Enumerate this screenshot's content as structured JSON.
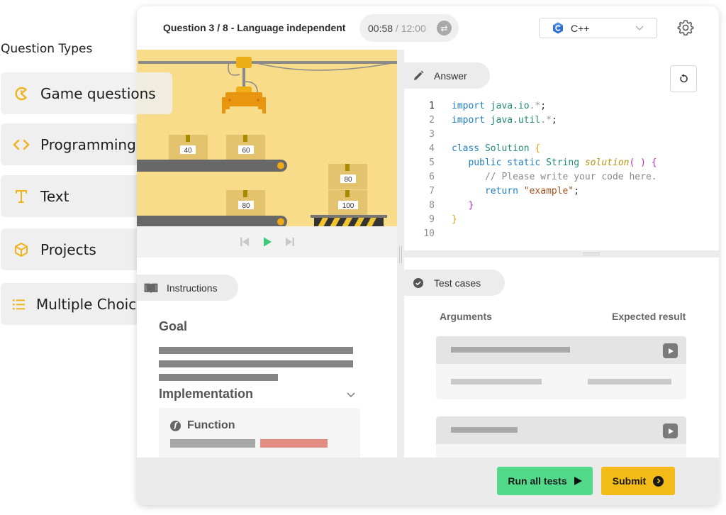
{
  "sidebar": {
    "title": "Question Types",
    "items": [
      {
        "label": "Game questions",
        "icon": "pacman-icon"
      },
      {
        "label": "Programming",
        "icon": "code-brackets-icon"
      },
      {
        "label": "Text",
        "icon": "text-t-icon"
      },
      {
        "label": "Projects",
        "icon": "cube-icon"
      },
      {
        "label": "Multiple Choice",
        "icon": "list-icon"
      }
    ],
    "accent_color": "#f0b31a"
  },
  "header": {
    "question_title": "Question 3 / 8 - Language independent",
    "timer": {
      "elapsed": "00:58",
      "separator": " / ",
      "total": "12:00"
    },
    "language": {
      "selected": "C++"
    }
  },
  "game": {
    "boxes_top_conveyor": [
      "40",
      "60"
    ],
    "boxes_bottom_conveyor": [
      "80"
    ],
    "boxes_stack": [
      "80",
      "100"
    ]
  },
  "instructions": {
    "tab_label": "Instructions",
    "goal_heading": "Goal",
    "implementation_heading": "Implementation",
    "function_label": "Function"
  },
  "answer": {
    "tab_label": "Answer",
    "line_numbers": [
      "1",
      "2",
      "3",
      "4",
      "5",
      "6",
      "7",
      "8",
      "9",
      "10"
    ],
    "code": {
      "l1_kw": "import",
      "l1_pkg": "java.io",
      "l1_tail": ".*",
      "l2_kw": "import",
      "l2_pkg": "java.util",
      "l2_tail": ".*",
      "l4_kw": "class",
      "l4_name": "Solution",
      "l5_mods": "public static",
      "l5_type": "String",
      "l5_fn": "solution",
      "l6_comment": "// Please write your code here.",
      "l7_kw": "return",
      "l7_str": "\"example\""
    }
  },
  "test_cases": {
    "tab_label": "Test cases",
    "col_arguments": "Arguments",
    "col_expected": "Expected result"
  },
  "footer": {
    "run_label": "Run all tests",
    "submit_label": "Submit",
    "run_color": "#52da8a",
    "submit_color": "#f2bb17"
  }
}
